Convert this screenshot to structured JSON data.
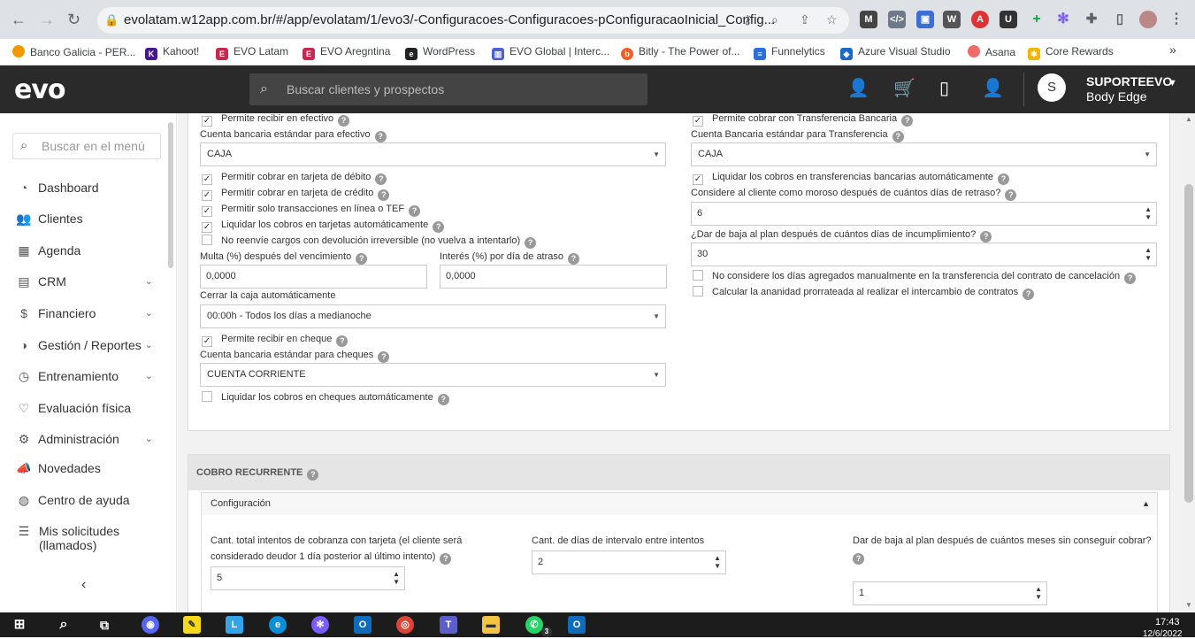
{
  "browser": {
    "url": "evolatam.w12app.com.br/#/app/evolatam/1/evo3/-Configuracoes-Configuracoes-pConfiguracaoInicial_Config...",
    "bookmarks": [
      "Banco Galicia - PER...",
      "Kahoot!",
      "EVO Latam",
      "EVO Aregntina",
      "WordPress",
      "EVO Global | Interc...",
      "Bitly - The Power of...",
      "Funnelytics",
      "Azure Visual Studio",
      "Asana",
      "Core Rewards"
    ]
  },
  "header": {
    "logo": "evo",
    "search_placeholder": "Buscar clientes y prospectos",
    "user_initial": "S",
    "user_name": "SUPORTEEVO",
    "company": "Body Edge"
  },
  "sidebar": {
    "search_placeholder": "Buscar en el menú",
    "items": [
      {
        "label": "Dashboard"
      },
      {
        "label": "Clientes"
      },
      {
        "label": "Agenda"
      },
      {
        "label": "CRM"
      },
      {
        "label": "Financiero"
      },
      {
        "label": "Gestión / Reportes"
      },
      {
        "label": "Entrenamiento"
      },
      {
        "label": "Evaluación física"
      },
      {
        "label": "Administración"
      },
      {
        "label": "Novedades"
      },
      {
        "label": "Centro de ayuda"
      },
      {
        "label": "Mis solicitudes\n(llamados)"
      }
    ]
  },
  "left": {
    "cash_allowed": "Permite recibir en efectivo",
    "cash_account_label": "Cuenta bancaria estándar para efectivo",
    "cash_account_value": "CAJA",
    "debit": "Permitir cobrar en tarjeta de débito",
    "credit": "Permitir cobrar en tarjeta de crédito",
    "online_only": "Permitir solo transacciones en línea o TEF",
    "liquidate_cards": "Liquidar los cobros en tarjetas automáticamente",
    "no_resend": "No reenvíe cargos con devolución irreversible (no vuelva a intentarlo)",
    "fine_label": "Multa (%) después del vencimiento",
    "fine_value": "0,0000",
    "interest_label": "Interés (%) por día de atraso",
    "interest_value": "0,0000",
    "close_cash_label": "Cerrar la caja automáticamente",
    "close_cash_value": "00:00h - Todos los días a medianoche",
    "cheque_allowed": "Permite recibir en cheque",
    "cheque_account_label": "Cuenta bancaria estándar para cheques",
    "cheque_account_value": "CUENTA CORRIENTE",
    "liquidate_cheques": "Liquidar los cobros en cheques automáticamente"
  },
  "right": {
    "transfer_allowed": "Permite cobrar con Transferencia Bancaria",
    "transfer_account_label": "Cuenta Bancaria estándar para Transferencia",
    "transfer_account_value": "CAJA",
    "liquidate_transfers": "Liquidar los cobros en transferencias bancarias automáticamente",
    "defaulter_label": "Considere al cliente como moroso después de cuántos días de retraso?",
    "defaulter_value": "6",
    "cancel_label": "¿Dar de baja al plan después de cuántos días de incumplimiento?",
    "cancel_value": "30",
    "no_consider_days": "No considere los días agregados manualmente en la transferencia del contrato de cancelación",
    "prorated": "Calcular la ananidad prorrateada al realizar el intercambio de contratos"
  },
  "recurring": {
    "title": "COBRO RECURRENTE",
    "config": "Configuración",
    "attempts_label_1": "Cant. total intentos de cobranza con tarjeta (el cliente será",
    "attempts_label_2": "considerado deudor 1 día posterior al último intento)",
    "attempts_value": "5",
    "interval_label": "Cant. de días de intervalo entre intentos",
    "interval_value": "2",
    "months_label": "Dar de baja al plan después de cuántos meses sin conseguir cobrar?",
    "months_value": "1"
  },
  "taskbar": {
    "time": "17:43",
    "date": "12/6/2022",
    "badge": "3"
  }
}
